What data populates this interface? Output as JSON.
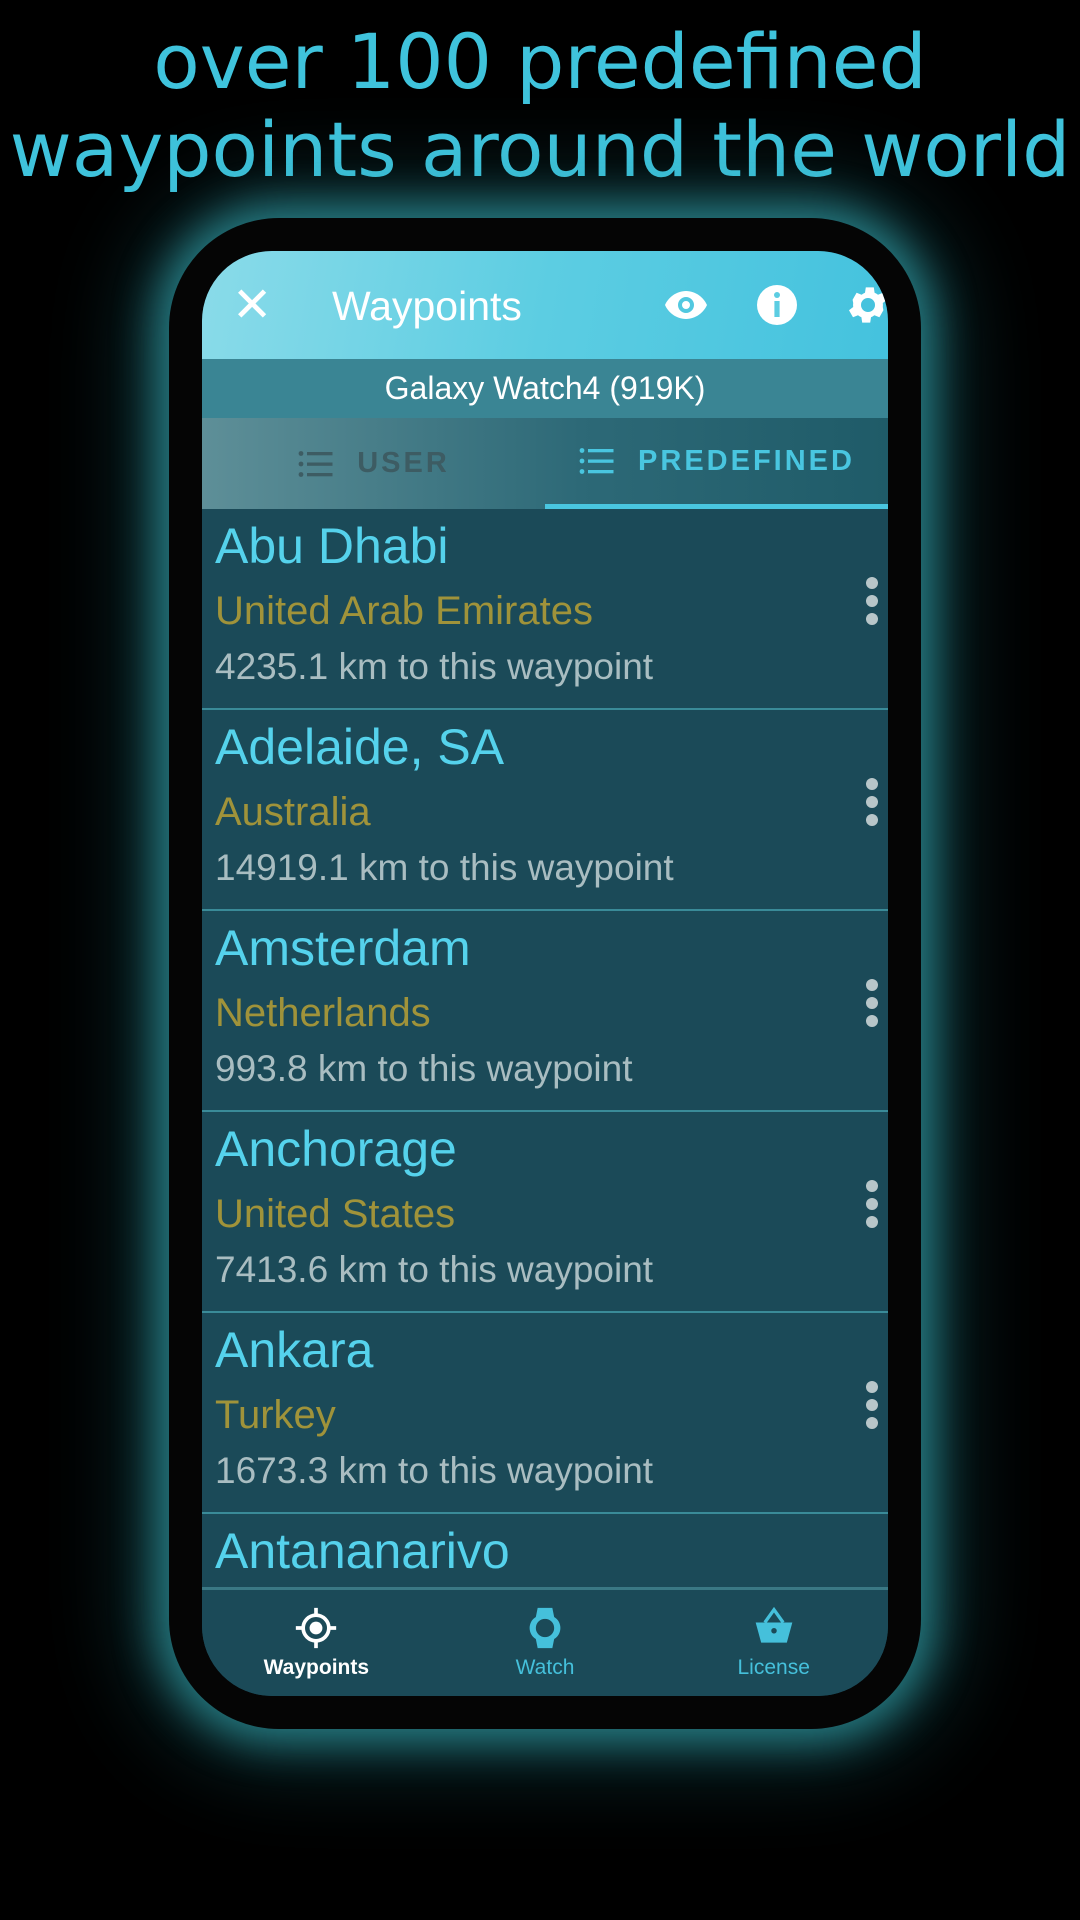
{
  "headline": {
    "line1": "over 100 predefined",
    "line2": "waypoints around the world"
  },
  "appbar": {
    "title": "Waypoints",
    "close_icon": "close-icon",
    "actions": [
      "eye-icon",
      "info-icon",
      "gear-icon"
    ]
  },
  "device": "Galaxy Watch4 (919K)",
  "tabs": [
    {
      "label": "USER",
      "active": false
    },
    {
      "label": "PREDEFINED",
      "active": true
    }
  ],
  "waypoints": [
    {
      "name": "Abu Dhabi",
      "country": "United Arab Emirates",
      "distance": "4235.1 km to this waypoint"
    },
    {
      "name": "Adelaide, SA",
      "country": "Australia",
      "distance": "14919.1 km to this waypoint"
    },
    {
      "name": "Amsterdam",
      "country": "Netherlands",
      "distance": "993.8 km to this waypoint"
    },
    {
      "name": "Anchorage",
      "country": "United States",
      "distance": "7413.6 km to this waypoint"
    },
    {
      "name": "Ankara",
      "country": "Turkey",
      "distance": "1673.3 km to this waypoint"
    },
    {
      "name": "Antananarivo"
    }
  ],
  "nav": [
    {
      "label": "Waypoints",
      "active": true
    },
    {
      "label": "Watch"
    },
    {
      "label": "License"
    }
  ],
  "colors": {
    "accent": "#49c6e0",
    "country": "#a0933a",
    "background": "#1b4a58"
  }
}
